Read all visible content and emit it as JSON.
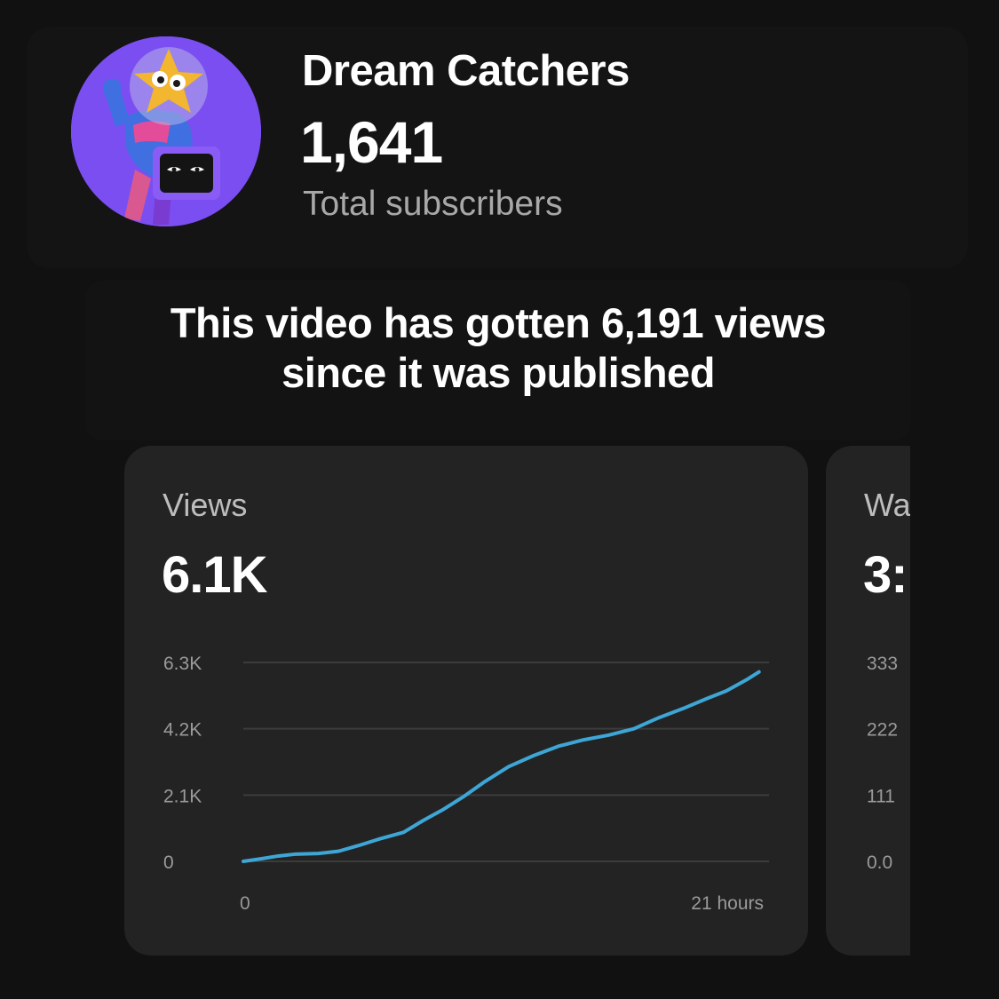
{
  "channel": {
    "name": "Dream Catchers",
    "subscriber_count": "1,641",
    "subscriber_label": "Total subscribers",
    "avatar_icon": "mascot-avatar-icon"
  },
  "headline": {
    "line1": "This video has gotten 6,191 views",
    "line2": "since it was published"
  },
  "views_card": {
    "title": "Views",
    "value": "6.1K"
  },
  "watch_card": {
    "title_partial": "Wa",
    "value_partial": "3:"
  },
  "colors": {
    "background": "#111111",
    "card": "#232323",
    "line": "#3ea6d6",
    "grid": "#3c3c3c"
  },
  "chart_data": [
    {
      "type": "line",
      "title": "Views",
      "ytick_labels": [
        "0",
        "2.1K",
        "4.2K",
        "6.3K"
      ],
      "ylim": [
        0,
        6300
      ],
      "xtick_labels": [
        "0",
        "21 hours"
      ],
      "xlim": [
        0,
        21
      ],
      "grid": true,
      "series": [
        {
          "values": [
            [
              0,
              0
            ],
            [
              0.7,
              80
            ],
            [
              1.4,
              170
            ],
            [
              2.1,
              230
            ],
            [
              3.0,
              250
            ],
            [
              3.8,
              320
            ],
            [
              4.6,
              500
            ],
            [
              5.4,
              700
            ],
            [
              6.4,
              920
            ],
            [
              7.2,
              1300
            ],
            [
              8.0,
              1650
            ],
            [
              8.8,
              2050
            ],
            [
              9.6,
              2500
            ],
            [
              10.6,
              3000
            ],
            [
              11.6,
              3350
            ],
            [
              12.6,
              3650
            ],
            [
              13.6,
              3850
            ],
            [
              14.6,
              4000
            ],
            [
              15.6,
              4200
            ],
            [
              16.6,
              4550
            ],
            [
              17.6,
              4850
            ],
            [
              18.5,
              5150
            ],
            [
              19.3,
              5400
            ],
            [
              20.1,
              5750
            ],
            [
              20.6,
              6000
            ]
          ]
        }
      ]
    },
    {
      "type": "line",
      "title": "Wa",
      "ytick_labels": [
        "0.0",
        "111",
        "222",
        "333"
      ],
      "ylim": [
        0,
        333
      ],
      "grid": true
    }
  ]
}
